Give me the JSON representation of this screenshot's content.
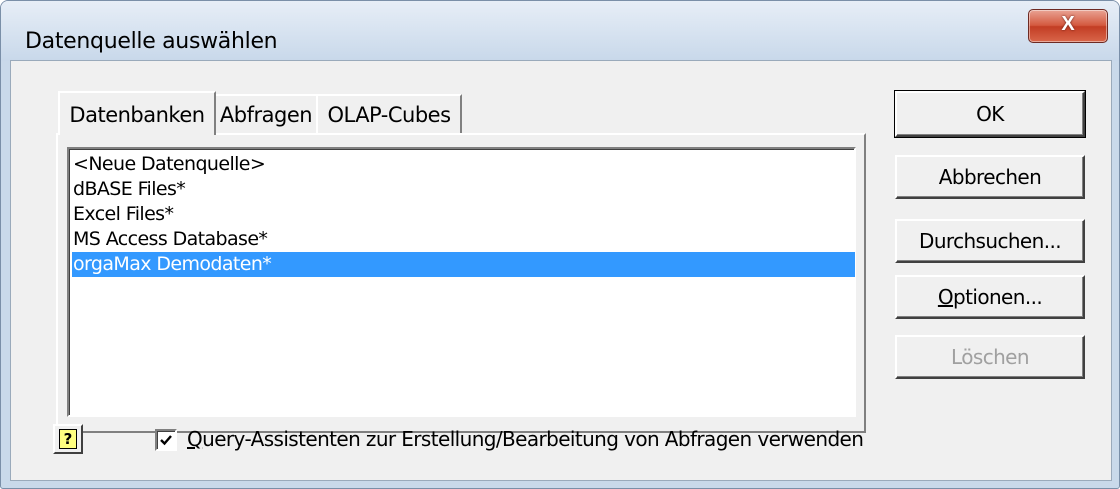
{
  "window": {
    "title": "Datenquelle auswählen",
    "close_glyph": "X"
  },
  "tabs": [
    {
      "label": "Datenbanken",
      "active": true
    },
    {
      "label": "Abfragen",
      "active": false
    },
    {
      "label": "OLAP-Cubes",
      "active": false
    }
  ],
  "datasources": [
    {
      "label": "<Neue Datenquelle>",
      "selected": false
    },
    {
      "label": "dBASE Files*",
      "selected": false
    },
    {
      "label": "Excel Files*",
      "selected": false
    },
    {
      "label": "MS Access Database*",
      "selected": false
    },
    {
      "label": "orgaMax Demodaten*",
      "selected": true
    }
  ],
  "buttons": {
    "ok": "OK",
    "cancel": "Abbrechen",
    "browse": "Durchsuchen...",
    "options_first": "O",
    "options_rest": "ptionen...",
    "delete": "Löschen"
  },
  "help": {
    "glyph": "?"
  },
  "query_wizard": {
    "checked": true,
    "label_first": "Q",
    "label_rest": "uery-Assistenten zur Erstellung/Bearbeitung von Abfragen verwenden"
  },
  "colors": {
    "selection": "#3399ff",
    "close_button": "#c9492f",
    "dialog_bg": "#f0f0f0"
  }
}
